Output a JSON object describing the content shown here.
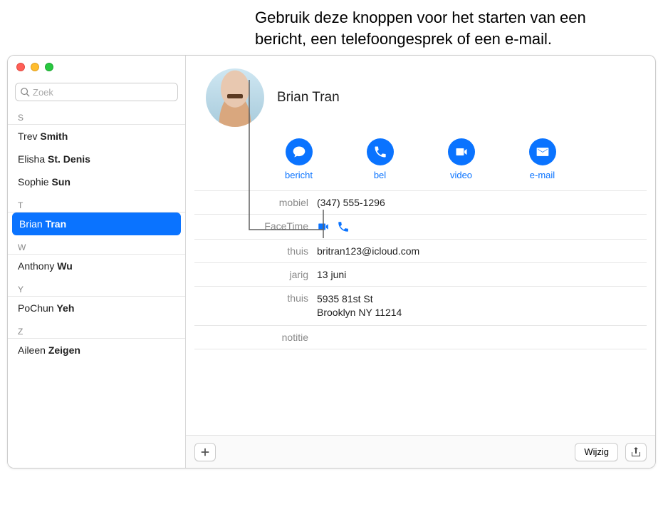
{
  "callout": "Gebruik deze knoppen voor het starten van een bericht, een telefoongesprek of een e-mail.",
  "search": {
    "placeholder": "Zoek"
  },
  "sections": [
    {
      "letter": "S",
      "items": [
        {
          "first": "Trev",
          "last": "Smith"
        },
        {
          "first": "Elisha",
          "last": "St. Denis"
        },
        {
          "first": "Sophie",
          "last": "Sun"
        }
      ]
    },
    {
      "letter": "T",
      "items": [
        {
          "first": "Brian",
          "last": "Tran",
          "selected": true
        }
      ]
    },
    {
      "letter": "W",
      "items": [
        {
          "first": "Anthony",
          "last": "Wu"
        }
      ]
    },
    {
      "letter": "Y",
      "items": [
        {
          "first": "PoChun",
          "last": "Yeh"
        }
      ]
    },
    {
      "letter": "Z",
      "items": [
        {
          "first": "Aileen",
          "last": "Zeigen"
        }
      ]
    }
  ],
  "contact": {
    "name": "Brian Tran",
    "actions": {
      "message": "bericht",
      "call": "bel",
      "video": "video",
      "mail": "e-mail"
    },
    "fields": {
      "mobile_label": "mobiel",
      "mobile_value": "(347) 555-1296",
      "facetime_label": "FaceTime",
      "home_email_label": "thuis",
      "home_email_value": "britran123@icloud.com",
      "birthday_label": "jarig",
      "birthday_value": "13 juni",
      "home_addr_label": "thuis",
      "home_addr_line1": "5935 81st St",
      "home_addr_line2": "Brooklyn NY 11214",
      "note_label": "notitie"
    }
  },
  "footer": {
    "edit": "Wijzig"
  }
}
